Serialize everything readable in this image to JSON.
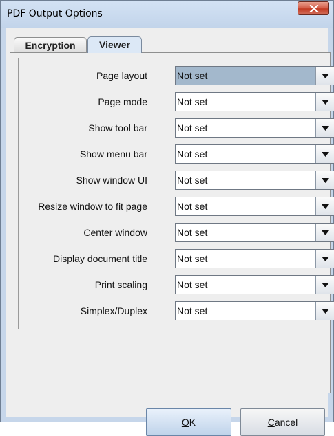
{
  "window": {
    "title": "PDF Output Options",
    "close_icon": "close-icon"
  },
  "tabs": [
    {
      "label": "Encryption",
      "selected": false
    },
    {
      "label": "Viewer",
      "selected": true
    }
  ],
  "viewer_options": [
    {
      "label": "Page layout",
      "value": "Not set"
    },
    {
      "label": "Page mode",
      "value": "Not set"
    },
    {
      "label": "Show tool bar",
      "value": "Not set"
    },
    {
      "label": "Show menu bar",
      "value": "Not set"
    },
    {
      "label": "Show window UI",
      "value": "Not set"
    },
    {
      "label": "Resize window to fit page",
      "value": "Not set"
    },
    {
      "label": "Center window",
      "value": "Not set"
    },
    {
      "label": "Display document title",
      "value": "Not set"
    },
    {
      "label": "Print scaling",
      "value": "Not set"
    },
    {
      "label": "Simplex/Duplex",
      "value": "Not set"
    }
  ],
  "buttons": {
    "ok": {
      "mnemonic": "O",
      "rest": "K"
    },
    "cancel": {
      "mnemonic": "C",
      "rest": "ancel"
    }
  },
  "colors": {
    "title_bar": "#c6d6ea",
    "close_button": "#c23b23",
    "selected_combo": "#a3b8cc"
  }
}
